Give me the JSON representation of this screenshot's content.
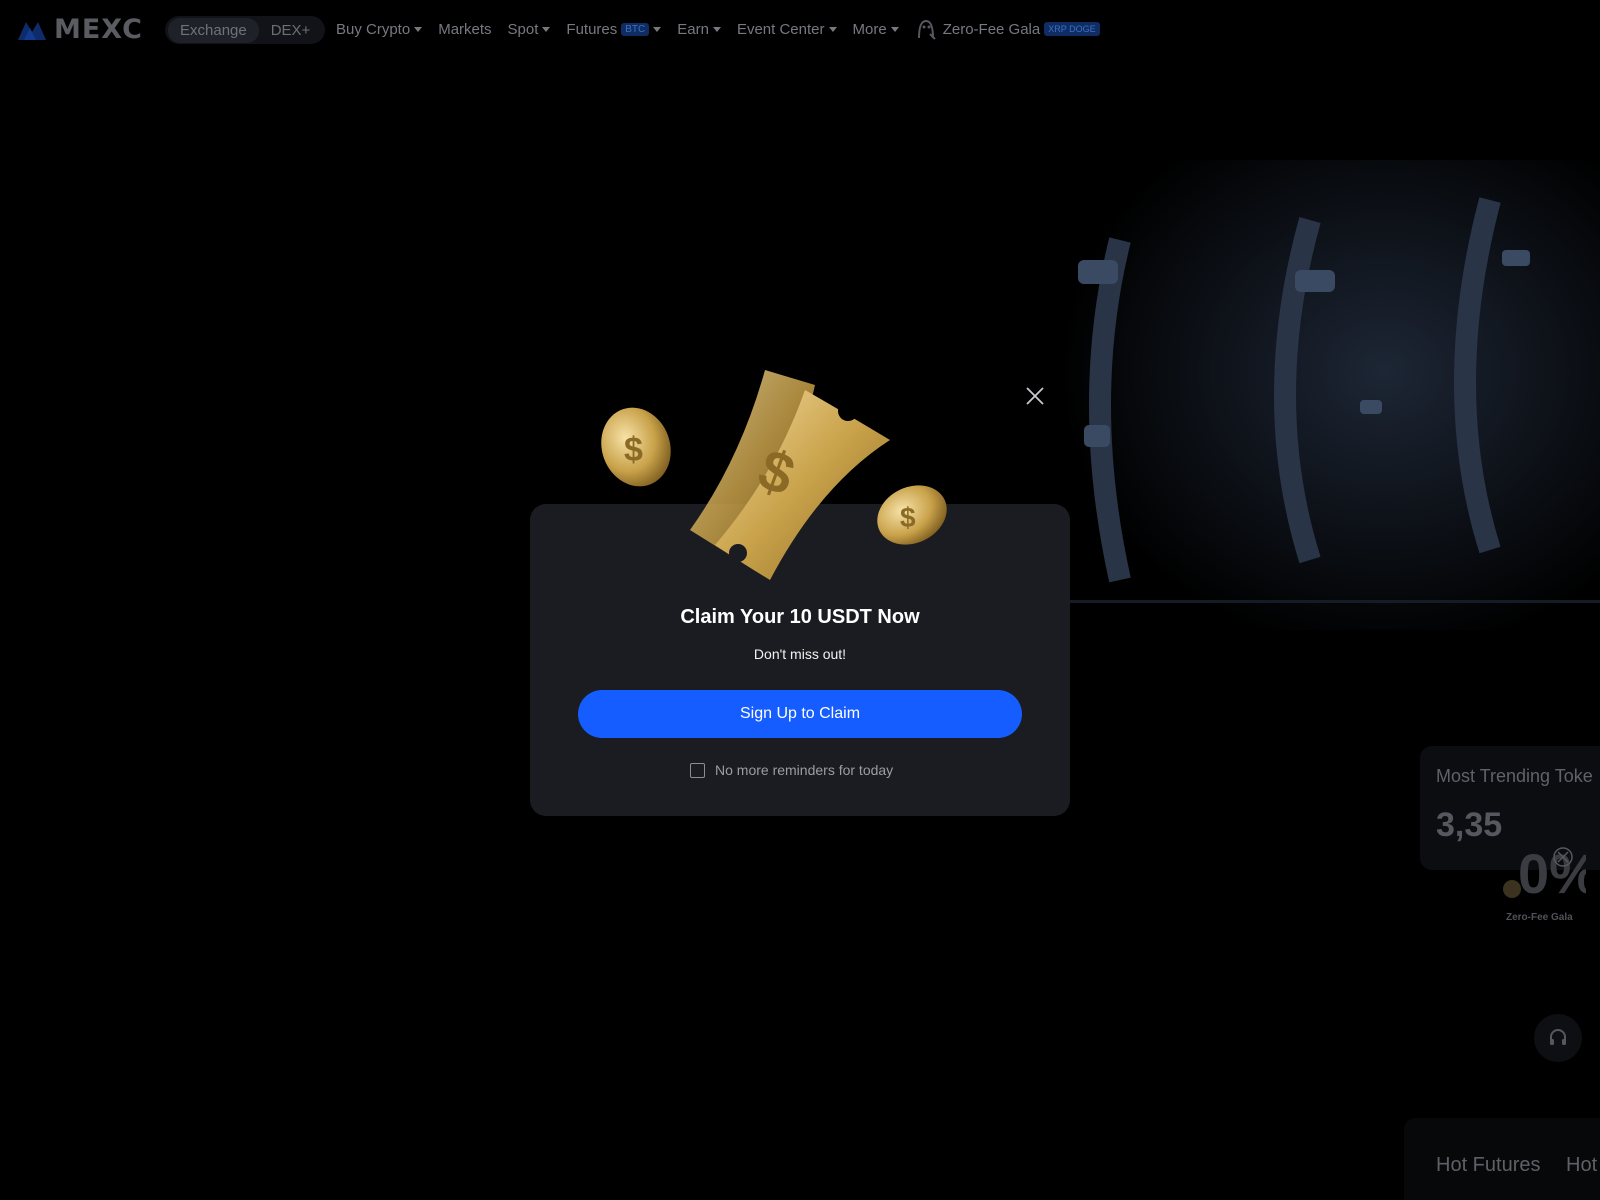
{
  "nav": {
    "logo_text": "MEXC",
    "segments": [
      "Exchange",
      "DEX+"
    ],
    "menu": [
      {
        "label": "Buy Crypto",
        "has_dropdown": true
      },
      {
        "label": "Markets",
        "has_dropdown": false
      },
      {
        "label": "Spot",
        "has_dropdown": true
      },
      {
        "label": "Futures",
        "badge": "BTC",
        "has_dropdown": true
      },
      {
        "label": "Earn",
        "has_dropdown": true
      },
      {
        "label": "Event Center",
        "has_dropdown": true
      },
      {
        "label": "More",
        "has_dropdown": true
      }
    ],
    "promo": {
      "label": "Zero-Fee Gala",
      "badge": "XRP DOGE"
    }
  },
  "background": {
    "trending_title": "Most Trending Toke",
    "trending_value": "3,35",
    "zero_fee_label": "Zero-Fee Gala",
    "zero_fee_text": "0%",
    "hot_tabs": [
      "Hot Futures",
      "Hot"
    ]
  },
  "modal": {
    "title": "Claim Your 10 USDT Now",
    "subtitle": "Don't miss out!",
    "cta_label": "Sign Up to Claim",
    "reminder_label": "No more reminders for today",
    "reminder_checked": false
  },
  "colors": {
    "accent": "#165dff",
    "modal_bg": "#1a1c21",
    "page_bg": "#000000",
    "coin_gold": "#c9a24a"
  },
  "icons": [
    "mexc-logo-icon",
    "dropdown-caret-icon",
    "gala-mascot-icon",
    "close-icon",
    "headset-icon",
    "coin-ticket-illustration"
  ]
}
